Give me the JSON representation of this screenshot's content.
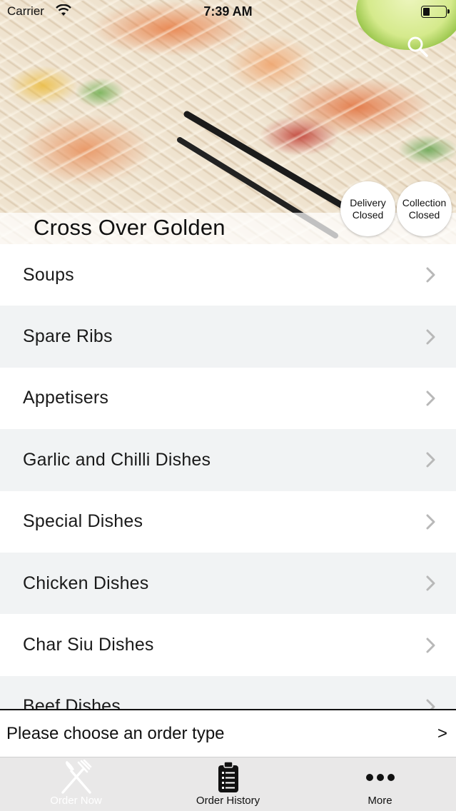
{
  "status_bar": {
    "carrier": "Carrier",
    "time": "7:39 AM"
  },
  "header": {
    "restaurant_name": "Cross Over Golden",
    "search_icon": "search-icon",
    "delivery": {
      "line1": "Delivery",
      "line2": "Closed"
    },
    "collection": {
      "line1": "Collection",
      "line2": "Closed"
    }
  },
  "menu": {
    "categories": [
      {
        "label": "Soups"
      },
      {
        "label": "Spare Ribs"
      },
      {
        "label": "Appetisers"
      },
      {
        "label": "Garlic and Chilli Dishes"
      },
      {
        "label": "Special Dishes"
      },
      {
        "label": "Chicken Dishes"
      },
      {
        "label": "Char Siu Dishes"
      },
      {
        "label": "Beef Dishes"
      }
    ]
  },
  "order_bar": {
    "text": "Please choose an order type",
    "arrow": ">"
  },
  "tab_bar": {
    "tabs": [
      {
        "label": "Order Now",
        "icon": "fork-knife-icon",
        "active": true
      },
      {
        "label": "Order History",
        "icon": "clipboard-list-icon",
        "active": false
      },
      {
        "label": "More",
        "icon": "ellipsis-icon",
        "active": false
      }
    ]
  },
  "colors": {
    "row_alt": "#f1f3f4",
    "tab_bar_bg": "#e9e8e8",
    "active_tab_text": "#ffffff"
  }
}
